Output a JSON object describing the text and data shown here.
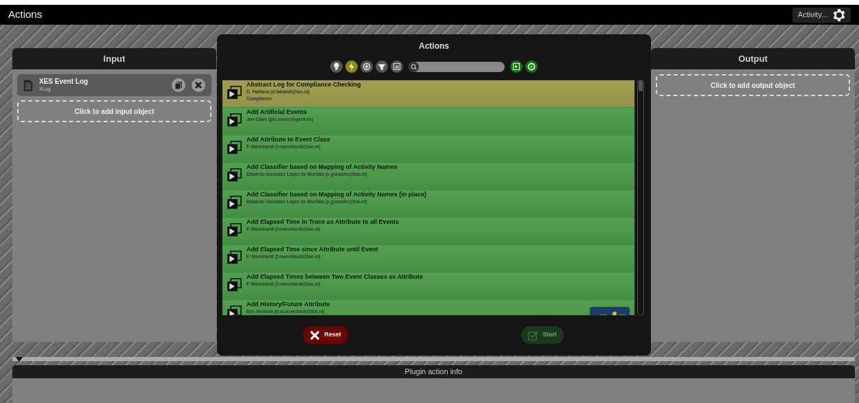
{
  "window": {
    "title": "Actions"
  },
  "activity_button": {
    "label": "Activity..."
  },
  "input_panel": {
    "title": "Input",
    "objects": [
      {
        "name": "XES Event Log",
        "type": "XLog"
      }
    ],
    "add_label": "Click to add input object"
  },
  "output_panel": {
    "title": "Output",
    "add_label": "Click to add output object"
  },
  "actions_dialog": {
    "title": "Actions",
    "filters": [
      {
        "kind": "bulb",
        "selected": false
      },
      {
        "kind": "bolt",
        "selected": true
      },
      {
        "kind": "plus",
        "selected": false
      },
      {
        "kind": "funnel",
        "selected": false
      },
      {
        "kind": "chart",
        "selected": false
      }
    ],
    "plugins": [
      {
        "title": "Abstract Log for Compliance Checking",
        "author": "D. Fahland (d.fahland@tue.nl)",
        "category": "Compliance",
        "selected": true
      },
      {
        "title": "Add Artificial Events",
        "author": "Jan Claes (jan.claes@ugent.be)",
        "selected": false
      },
      {
        "title": "Add Attribute to Event Class",
        "author": "F. Mannhardt (f.mannhardt@tue.nl)",
        "selected": false
      },
      {
        "title": "Add Classifier based on Mapping of Activity Names",
        "author": "Eduardo Gonzalez Lopez de Murillas (e.gonzalez@tue.nl)",
        "selected": false
      },
      {
        "title": "Add Classifier based on Mapping of Activity Names (in place)",
        "author": "Eduardo Gonzalez Lopez de Murillas (e.gonzalez@tue.nl)",
        "selected": false
      },
      {
        "title": "Add Elapsed Time in Trace as Attribute to all Events",
        "author": "F. Mannhardt (f.mannhardt@tue.nl)",
        "selected": false
      },
      {
        "title": "Add Elapsed Time since Attribute until Event",
        "author": "F. Mannhardt (f.mannhardt@tue.nl)",
        "selected": false
      },
      {
        "title": "Add Elapsed Times between Two Event Classes as Attribute",
        "author": "F. Mannhardt (f.mannhardt@tue.nl)",
        "selected": false
      },
      {
        "title": "Add History/Future Attribute",
        "author": "Eric Verbeek (h.m.w.verbeek@tue.nl)",
        "selected": false,
        "logo": true
      }
    ],
    "buttons": [
      {
        "kind": "reset",
        "label": "Reset",
        "disabled": false
      },
      {
        "kind": "start",
        "label": "Start",
        "disabled": true
      }
    ]
  },
  "info_panel": {
    "title": "Plugin action info"
  }
}
